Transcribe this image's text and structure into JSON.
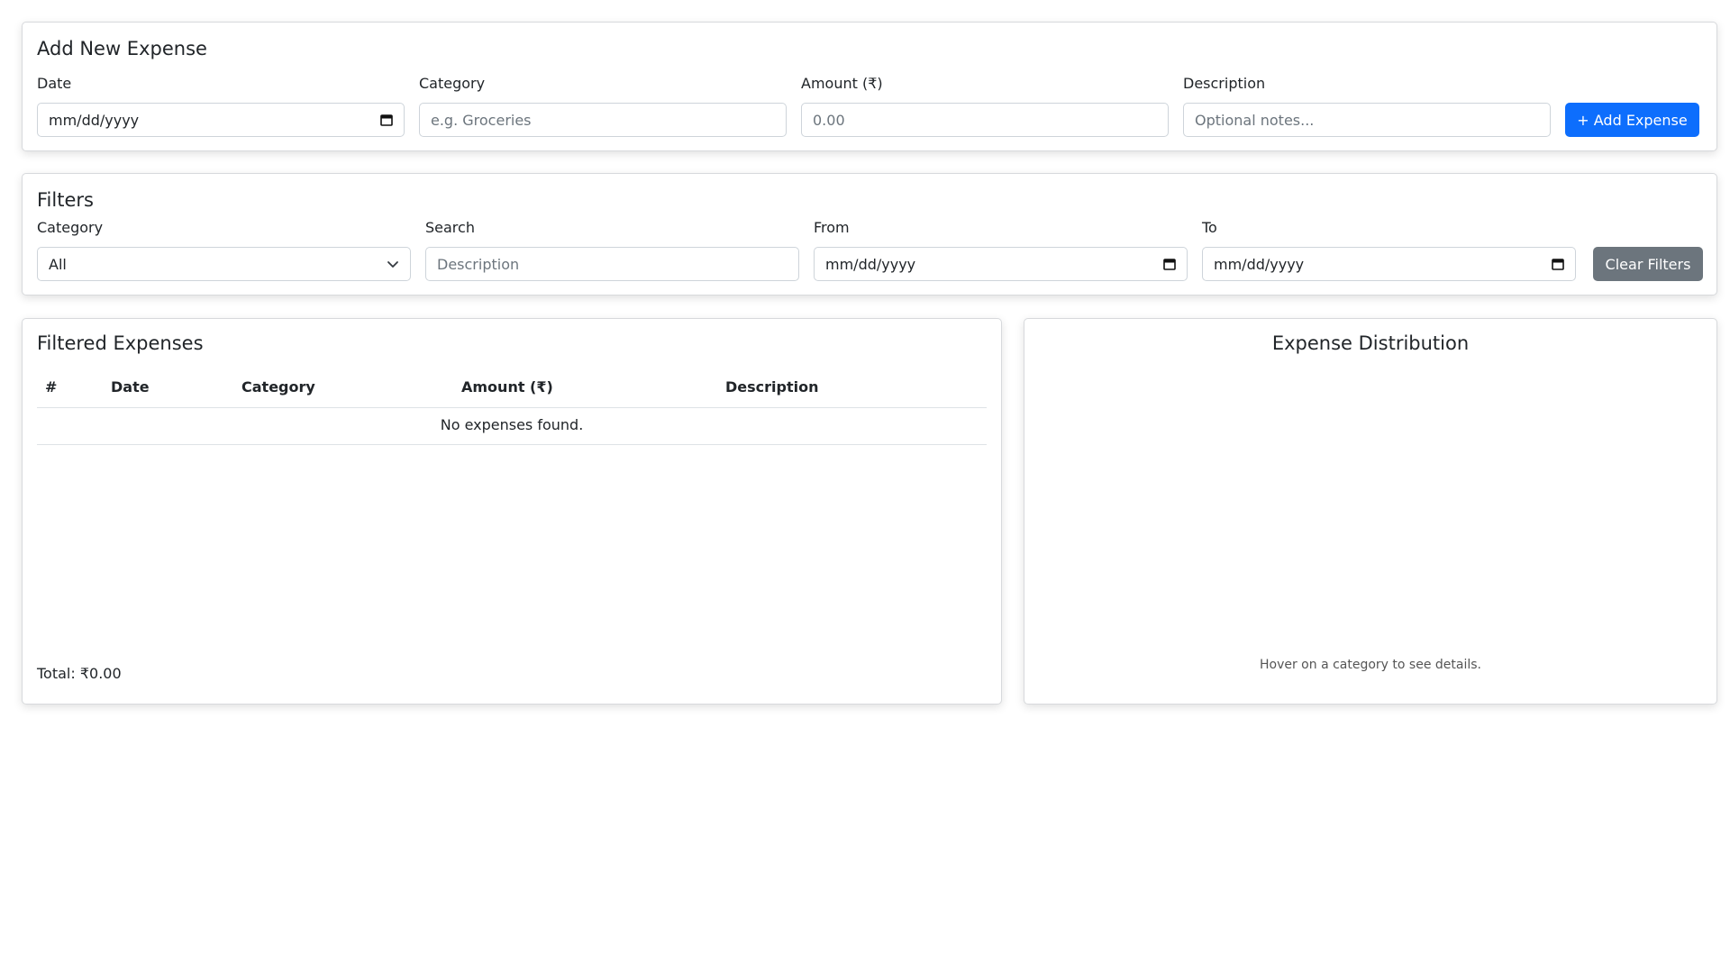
{
  "add_expense": {
    "title": "Add New Expense",
    "date_label": "Date",
    "date_placeholder": "mm/dd/yyyy",
    "category_label": "Category",
    "category_placeholder": "e.g. Groceries",
    "amount_label": "Amount (₹)",
    "amount_placeholder": "0.00",
    "description_label": "Description",
    "description_placeholder": "Optional notes...",
    "add_button": "+ Add Expense"
  },
  "filters": {
    "title": "Filters",
    "category_label": "Category",
    "category_value": "All",
    "search_label": "Search",
    "search_placeholder": "Description",
    "from_label": "From",
    "from_placeholder": "mm/dd/yyyy",
    "to_label": "To",
    "to_placeholder": "mm/dd/yyyy",
    "clear_button": "Clear Filters"
  },
  "expenses_table": {
    "title": "Filtered Expenses",
    "columns": [
      "#",
      "Date",
      "Category",
      "Amount (₹)",
      "Description"
    ],
    "empty_message": "No expenses found.",
    "total": "Total: ₹0.00"
  },
  "distribution": {
    "title": "Expense Distribution",
    "hint": "Hover on a category to see details."
  },
  "colors": {
    "primary": "#0d6efd",
    "secondary": "#6c757d"
  }
}
